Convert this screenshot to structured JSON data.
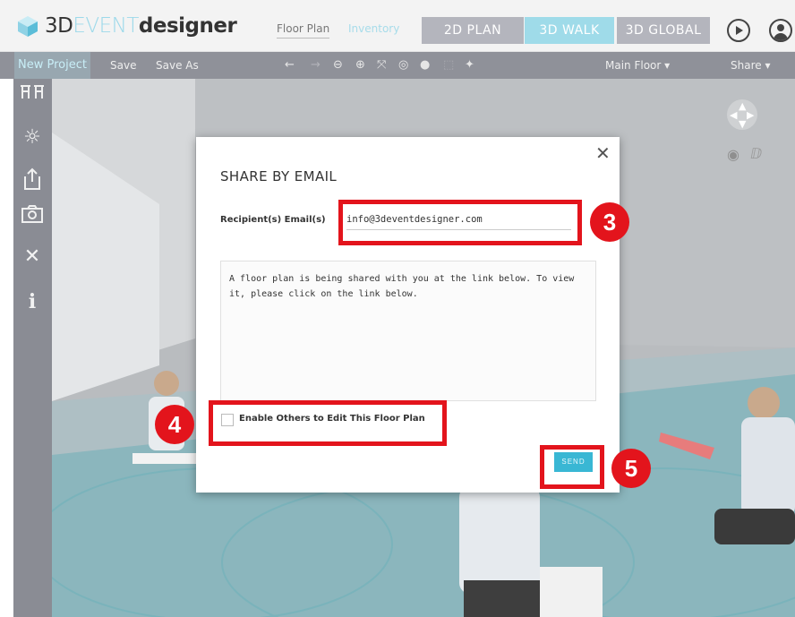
{
  "header": {
    "logo": {
      "part1": "3D",
      "part2": "EVENT",
      "part3": "designer"
    },
    "nav_links": {
      "floor_plan": "Floor Plan",
      "inventory": "Inventory"
    },
    "modes": {
      "plan_2d": "2D PLAN",
      "walk_3d": "3D WALK",
      "global_3d": "3D GLOBAL"
    }
  },
  "toolbar": {
    "new_project": "New Project",
    "save": "Save",
    "save_as": "Save As",
    "floor_selector": "Main Floor  ▾",
    "share": "Share  ▾"
  },
  "sidebar": {
    "icons": [
      "tables-icon",
      "lighting-icon",
      "export-icon",
      "camera-icon",
      "tools-icon",
      "info-icon"
    ],
    "info_glyph": "i"
  },
  "modal": {
    "title": "SHARE BY EMAIL",
    "recipient_label": "Recipient(s) Email(s)",
    "recipient_value": "info@3deventdesigner.com",
    "message": "A floor plan is being shared with you at the link below. To view it, please click on the link below.",
    "enable_edit_label": "Enable Others to Edit This Floor Plan",
    "enable_edit_checked": false,
    "send_label": "SEND",
    "close_glyph": "✕"
  },
  "annotations": {
    "step3": "3",
    "step4": "4",
    "step5": "5"
  },
  "colors": {
    "accent": "#39b7d4",
    "highlight": "#e3141c",
    "toolbar": "#8f9199",
    "sidebar": "#8a8c94"
  }
}
